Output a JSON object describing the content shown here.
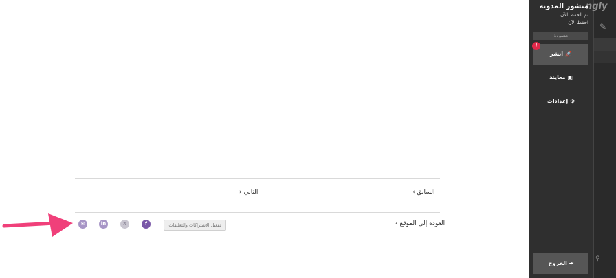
{
  "post_nav": {
    "prev_label": "السابق",
    "next_label": "التالي"
  },
  "footer": {
    "back_to_site": "العودة إلى الموقع",
    "enable_subs_label": "تفعيل الاشتراكات والتعليقات",
    "social": {
      "facebook": "f",
      "x": "𝕏",
      "linkedin": "in",
      "email": "✉"
    }
  },
  "panel": {
    "title": "منشور المدونة",
    "saved_status": "تم الحفظ الآن.",
    "save_now": "احفظ الآن",
    "status_badge": "مسودة",
    "publish_label": "انشر",
    "alert_badge": "!",
    "preview_label": "معاينة",
    "settings_label": "إعدادات",
    "exit_label": "الخروج",
    "logo_text": "ngly"
  },
  "colors": {
    "panel_bg": "#2f2f2f",
    "button_bg": "#565656",
    "accent_social": "#7a58a8",
    "alert": "#e0294a",
    "annotation_arrow": "#f0407a"
  }
}
